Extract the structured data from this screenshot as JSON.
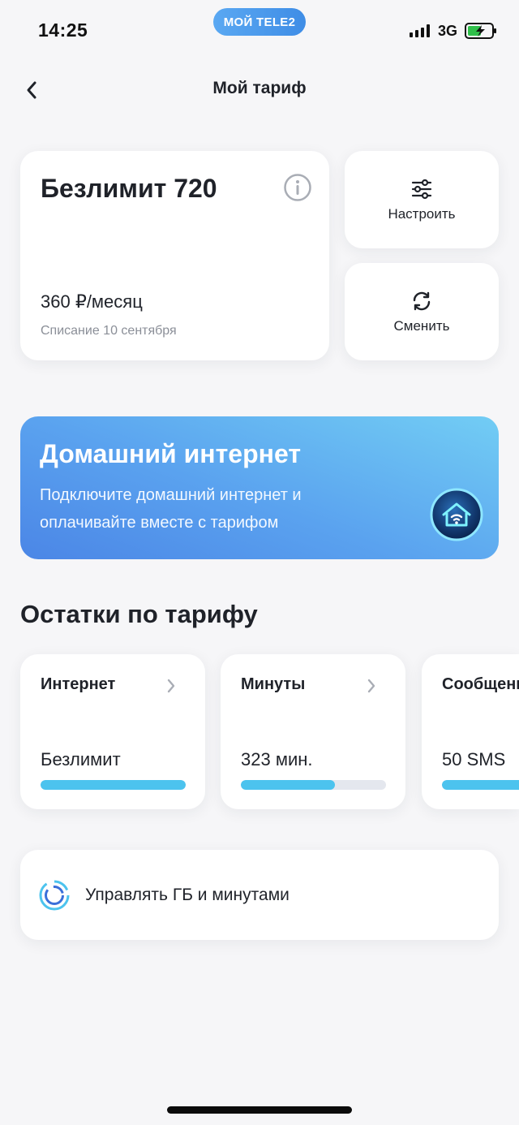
{
  "status_bar": {
    "time": "14:25",
    "carrier_pill": "МОЙ TELE2",
    "network": "3G",
    "signal_icon": "cellular-signal-icon",
    "battery_icon": "battery-charging-icon"
  },
  "header": {
    "title": "Мой тариф",
    "back_icon": "chevron-left-icon"
  },
  "tariff": {
    "name": "Безлимит 720",
    "price": "360 ₽/месяц",
    "charge_date": "Списание 10 сентября",
    "info_icon": "info-icon"
  },
  "actions": [
    {
      "label": "Настроить",
      "icon": "sliders-icon"
    },
    {
      "label": "Сменить",
      "icon": "refresh-icon"
    }
  ],
  "banner": {
    "title": "Домашний интернет",
    "text": "Подключите домашний интернет и оплачивайте вместе с тарифом",
    "icon": "home-wifi-icon"
  },
  "remains": {
    "title": "Остатки по тарифу",
    "items": [
      {
        "title": "Интернет",
        "value": "Безлимит",
        "fill": 1.0
      },
      {
        "title": "Минуты",
        "value": "323 мин.",
        "fill": 0.65
      },
      {
        "title": "Сообщения",
        "value": "50 SMS",
        "fill": 1.0
      }
    ]
  },
  "manage": {
    "label": "Управлять ГБ и минутами",
    "icon": "rings-icon"
  },
  "colors": {
    "accent": "#4cc3ee",
    "banner_start": "#72cdf4",
    "banner_end": "#4b86e6",
    "background": "#f6f6f8"
  }
}
